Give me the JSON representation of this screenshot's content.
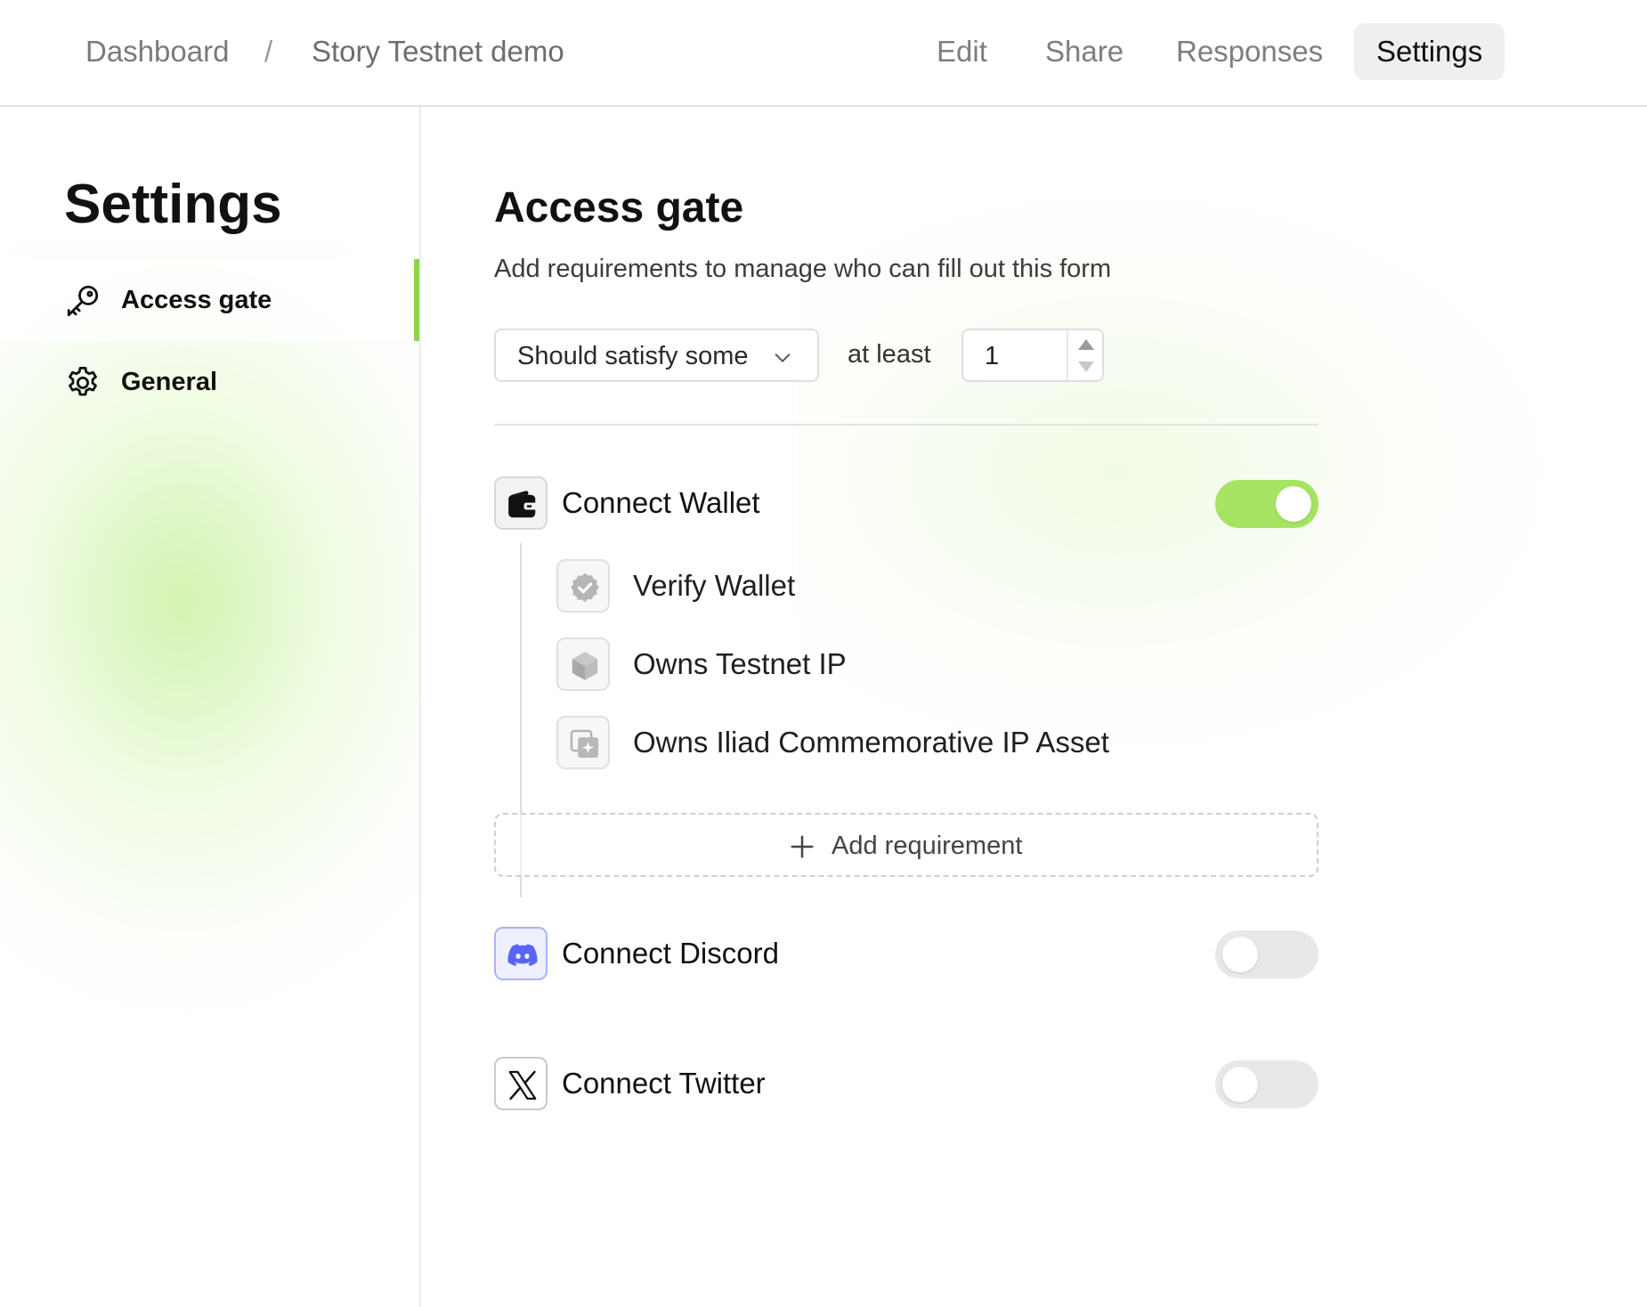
{
  "breadcrumb": {
    "home": "Dashboard",
    "separator": "/",
    "current": "Story Testnet demo"
  },
  "nav": {
    "edit": "Edit",
    "share": "Share",
    "responses": "Responses",
    "settings": "Settings",
    "active": "Settings"
  },
  "sidebar": {
    "title": "Settings",
    "items": [
      {
        "label": "Access gate",
        "icon": "key-icon",
        "active": true
      },
      {
        "label": "General",
        "icon": "gear-icon",
        "active": false
      }
    ]
  },
  "main": {
    "title": "Access gate",
    "description": "Add requirements to manage who can fill out this form",
    "condition_select": {
      "value": "Should satisfy some"
    },
    "at_least_label": "at least",
    "at_least_value": "1",
    "requirements": [
      {
        "label": "Connect Wallet",
        "icon": "wallet-icon",
        "enabled": true,
        "sub_requirements": [
          {
            "label": "Verify Wallet",
            "icon": "verified-badge-icon"
          },
          {
            "label": "Owns Testnet IP",
            "icon": "cube-icon"
          },
          {
            "label": "Owns Iliad Commemorative IP Asset",
            "icon": "asset-sparkle-icon"
          }
        ]
      },
      {
        "label": "Connect Discord",
        "icon": "discord-icon",
        "enabled": false
      },
      {
        "label": "Connect Twitter",
        "icon": "x-logo-icon",
        "enabled": false
      }
    ],
    "add_requirement_label": "Add requirement"
  },
  "colors": {
    "accent_green": "#8bd54a",
    "toggle_on": "#a6e363",
    "toggle_off": "#e8e8e8",
    "discord": "#5865f2"
  }
}
